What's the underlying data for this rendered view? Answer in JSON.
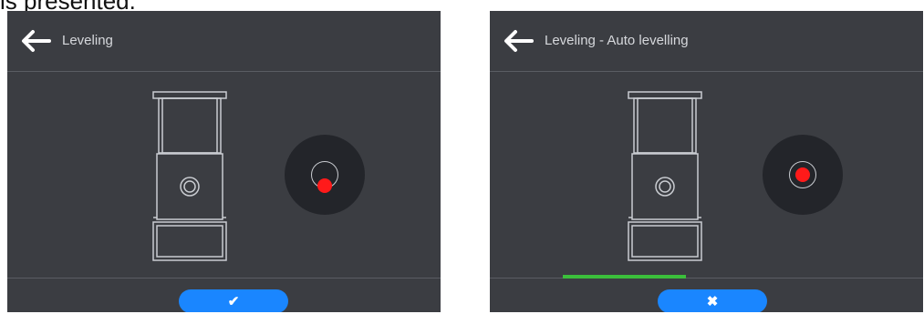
{
  "caption_fragment": "is presented.",
  "left_screen": {
    "title": "Leveling",
    "back_icon": "arrow-left-icon",
    "bubble_state": "off-center",
    "confirm_button": {
      "icon": "checkmark-icon",
      "glyph": "✔"
    }
  },
  "right_screen": {
    "title": "Leveling - Auto levelling",
    "back_icon": "arrow-left-icon",
    "bubble_state": "centered",
    "progress": 0.43,
    "cancel_button": {
      "icon": "close-icon",
      "glyph": "✖"
    }
  },
  "colors": {
    "screen_bg": "#3b3d42",
    "indicator_bg": "#23252a",
    "bubble": "#ff1a1a",
    "button": "#1a86ff",
    "progress": "#3bbf3b"
  }
}
